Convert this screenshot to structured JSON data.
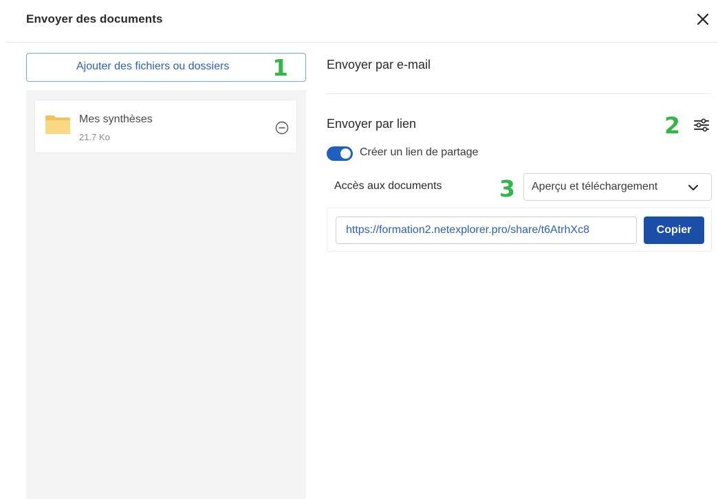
{
  "dialog": {
    "title": "Envoyer des documents",
    "close_icon": "close-icon"
  },
  "left": {
    "add_button_label": "Ajouter des fichiers ou dossiers",
    "files": [
      {
        "name": "Mes synthèses",
        "size": "21.7 Ko",
        "icon": "folder-icon"
      }
    ]
  },
  "right": {
    "email_section_label": "Envoyer par e-mail",
    "link_section_label": "Envoyer par lien",
    "settings_icon": "sliders-icon",
    "share_toggle": {
      "label": "Créer un lien de partage",
      "on": true
    },
    "access": {
      "label": "Accès aux documents",
      "selected": "Aperçu et téléchargement"
    },
    "link": {
      "url": "https://formation2.netexplorer.pro/share/t6AtrhXc8",
      "copy_label": "Copier"
    }
  },
  "annotations": [
    "1",
    "2",
    "3"
  ],
  "colors": {
    "accent": "#1f5fbf",
    "annotation": "#34b54a",
    "link_text": "#2c5fb3",
    "folder": "#f7d27a"
  }
}
